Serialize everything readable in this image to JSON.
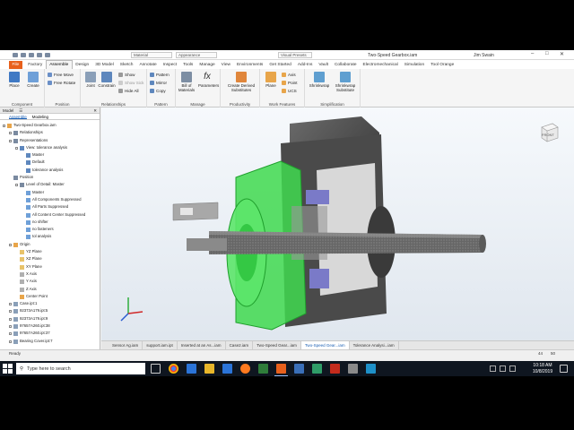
{
  "window": {
    "title": "Two-Speed Gearbox.iam",
    "user": "Jim Swain",
    "material": "Material",
    "appearance": "Appearance",
    "visual_preset": "Visual Presets"
  },
  "ribbon_tabs": [
    "File",
    "Factory",
    "Assemble",
    "Design",
    "3D Model",
    "Sketch",
    "Annotate",
    "Inspect",
    "Tools",
    "Manage",
    "View",
    "Environments",
    "Get Started",
    "Add-Ins",
    "Vault",
    "Collaborate",
    "Electromechanical",
    "Simulation",
    "Tool Orange"
  ],
  "ribbon": {
    "component": {
      "label": "Component",
      "place": "Place",
      "create": "Create"
    },
    "position": {
      "label": "Position",
      "free_move": "Free Move",
      "free_rotate": "Free Rotate"
    },
    "relationships": {
      "label": "Relationships",
      "joint": "Joint",
      "constrain": "Constrain",
      "show": "Show",
      "show_sick": "Show Sick",
      "hide_all": "Hide All"
    },
    "pattern": {
      "label": "Pattern",
      "pattern": "Pattern",
      "mirror": "Mirror",
      "copy": "Copy"
    },
    "manage": {
      "label": "Manage",
      "bom": "Bill of Materials",
      "parameters": "Parameters"
    },
    "productivity": {
      "label": "Productivity",
      "create_derived": "Create Derived Substitutes"
    },
    "work_features": {
      "label": "Work Features",
      "plane": "Plane",
      "axis": "Axis",
      "point": "Point",
      "ucs": "UCS"
    },
    "simplification": {
      "label": "Simplification",
      "shrinkwrap": "Shrinkwrap",
      "shrinkwrap_sub": "Shrinkwrap Substitute"
    }
  },
  "browser": {
    "title": "Model",
    "tabs": [
      "Assemble",
      "Modeling"
    ],
    "tree": [
      "Two-Speed Gearbox.iam",
      "Relationships",
      "Representations",
      "View: tolerance analysis",
      "Master",
      "Default",
      "tolerance analysis",
      "Position",
      "Level of Detail: Master",
      "Master",
      "All Components Suppressed",
      "All Parts Suppressed",
      "All Content Center Suppressed",
      "no shifter",
      "no fasteners",
      "tol analysis",
      "Origin",
      "YZ Plane",
      "XZ Plane",
      "XY Plane",
      "X Axis",
      "Y Axis",
      "Z Axis",
      "Center Point",
      "Case.ipt:1",
      "92373A179.ipt:5",
      "92373A179.ipt:9",
      "97657A260.ipt:38",
      "97657A260.ipt:37",
      "Bearing Cover.ipt:7"
    ]
  },
  "viewcube_label": "FRONT",
  "doc_tabs": [
    "Sensor Ag.iam",
    "support.iam.ipt",
    "Inserted at an As...iam",
    "Case2.iam",
    "Two-Speed Gear...iam",
    "Two-Speed Gear...iam",
    "Tolerance Analysi...iam"
  ],
  "status": {
    "text": "Ready",
    "n1": "44",
    "n2": "50"
  },
  "taskbar": {
    "search_placeholder": "Type here to search",
    "time": "10:18 AM",
    "date": "10/8/2019"
  },
  "colors": {
    "accent_file": "#e8601c",
    "highlight_green": "#3fd94f",
    "taskbar": "#0f1620"
  }
}
